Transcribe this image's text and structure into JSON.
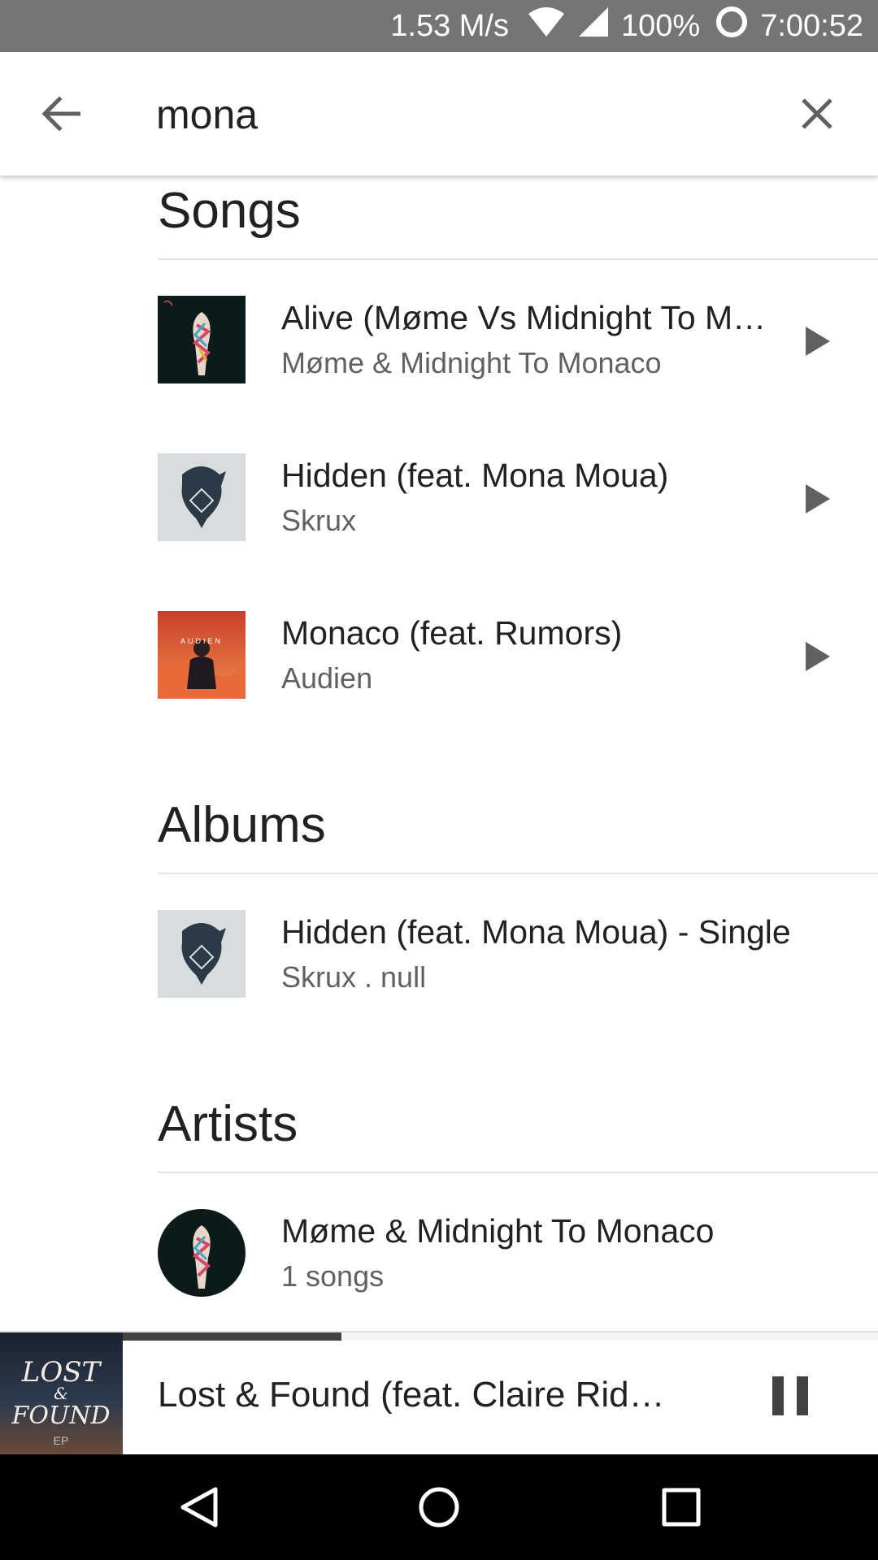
{
  "status_bar": {
    "speed": "1.53 M/s",
    "battery": "100%",
    "time": "7:00:52",
    "icons": [
      "wifi-icon",
      "signal-icon",
      "battery-icon"
    ]
  },
  "search": {
    "query": "mona",
    "back_icon": "arrow-back-icon",
    "clear_icon": "close-icon"
  },
  "sections": {
    "songs": {
      "title": "Songs",
      "items": [
        {
          "title": "Alive (Møme Vs Midnight To Monaco)",
          "artist": "Møme & Midnight To Monaco"
        },
        {
          "title": "Hidden (feat. Mona Moua)",
          "artist": "Skrux"
        },
        {
          "title": "Monaco (feat. Rumors)",
          "artist": "Audien"
        }
      ]
    },
    "albums": {
      "title": "Albums",
      "items": [
        {
          "title": "Hidden (feat. Mona Moua) - Single",
          "subtitle": "Skrux . null"
        }
      ]
    },
    "artists": {
      "title": "Artists",
      "items": [
        {
          "name": "Møme & Midnight To Monaco",
          "subtitle": "1 songs"
        }
      ]
    }
  },
  "now_playing": {
    "title": "Lost & Found (feat. Claire Ridgely)",
    "art_text": {
      "line1": "LOST",
      "line2": "&",
      "line3": "FOUND",
      "line4": "EP"
    },
    "progress": 0.29,
    "state": "playing"
  },
  "colors": {
    "status_bar": "#757575",
    "text_primary": "#212121",
    "text_secondary": "#616161",
    "accent": "#424242"
  }
}
